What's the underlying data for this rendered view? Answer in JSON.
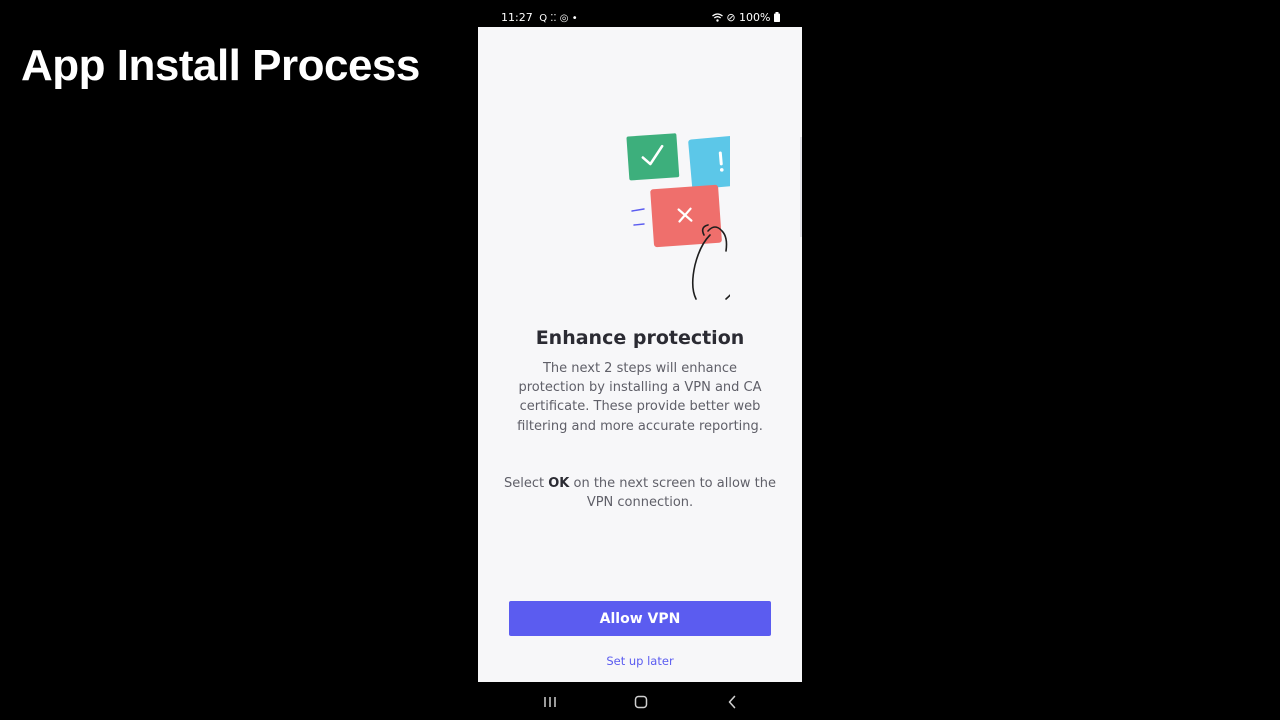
{
  "slide": {
    "title": "App Install Process"
  },
  "status_bar": {
    "time": "11:27",
    "left_icons": "Q ⁚⁚ ◎ •",
    "right_icons": "⊘",
    "battery": "100%"
  },
  "screen": {
    "heading": "Enhance protection",
    "body": "The next 2 steps will enhance protection by installing a VPN and CA certificate. These provide better web filtering and more accurate reporting.",
    "instruction": {
      "prefix": "Select ",
      "bold": "OK",
      "suffix": " on the next screen to allow the VPN connection."
    },
    "primary_button": "Allow VPN",
    "secondary_link": "Set up later"
  },
  "illustration": {
    "cards": [
      {
        "symbol": "✓",
        "color": "#3daf7c"
      },
      {
        "symbol": "!",
        "color": "#5cc7e8"
      },
      {
        "symbol": "×",
        "color": "#ef6f6c"
      }
    ],
    "line_color": "#1e1e1e",
    "accent_color": "#5b5cf0"
  },
  "nav_bar": {
    "icons": [
      "recent-apps-icon",
      "home-icon",
      "back-icon"
    ]
  },
  "colors": {
    "background": "#000000",
    "screen": "#f7f7f9",
    "accent": "#5b5cf0",
    "heading": "#2b2b33",
    "body": "#5f5f68"
  }
}
